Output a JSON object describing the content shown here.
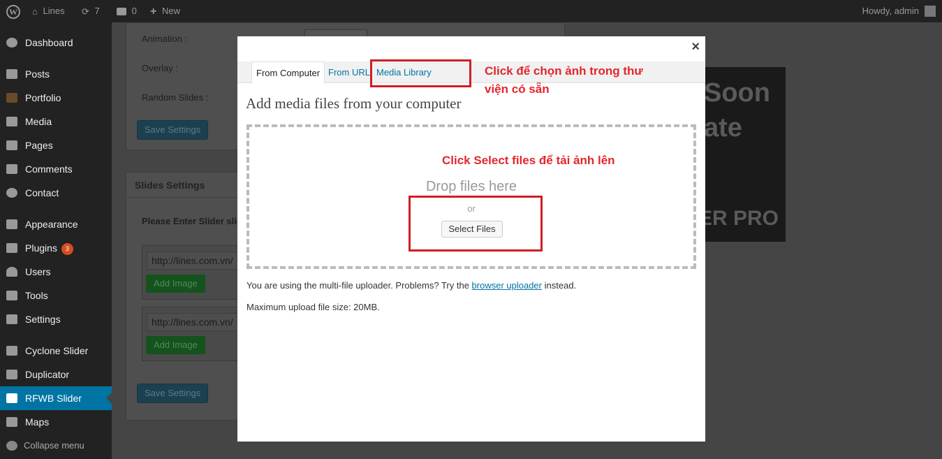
{
  "adminbar": {
    "site_name": "Lines",
    "updates_count": "7",
    "comments_count": "0",
    "new_label": "New",
    "howdy": "Howdy, admin"
  },
  "sidebar": {
    "items": [
      {
        "label": "Dashboard",
        "icon": "dashboard-icon"
      },
      {
        "label": "Posts",
        "icon": "pin-icon"
      },
      {
        "label": "Portfolio",
        "icon": "briefcase-icon"
      },
      {
        "label": "Media",
        "icon": "media-icon"
      },
      {
        "label": "Pages",
        "icon": "pages-icon"
      },
      {
        "label": "Comments",
        "icon": "comment-icon"
      },
      {
        "label": "Contact",
        "icon": "gear-icon"
      },
      {
        "label": "Appearance",
        "icon": "brush-icon"
      },
      {
        "label": "Plugins",
        "icon": "plug-icon",
        "badge": "3"
      },
      {
        "label": "Users",
        "icon": "user-icon"
      },
      {
        "label": "Tools",
        "icon": "wrench-icon"
      },
      {
        "label": "Settings",
        "icon": "settings-icon"
      },
      {
        "label": "Cyclone Slider",
        "icon": "slider-icon"
      },
      {
        "label": "Duplicator",
        "icon": "duplicator-icon"
      },
      {
        "label": "RFWB Slider",
        "icon": "rfwb-slider-icon",
        "active": true
      },
      {
        "label": "Maps",
        "icon": "map-icon"
      },
      {
        "label": "Collapse menu",
        "icon": "collapse-icon"
      }
    ]
  },
  "background": {
    "animation_label": "Animation :",
    "overlay_label": "Overlay :",
    "random_slides_label": "Random Slides :",
    "save_settings": "Save Settings",
    "slides_settings_title": "Slides Settings",
    "enter_slider_label": "Please Enter Slider slid",
    "url_value": "http://lines.com.vn/",
    "add_image": "Add Image",
    "preview_texts": [
      "Soon",
      "ate",
      "ER PRO"
    ]
  },
  "modal": {
    "close": "×",
    "tabs": [
      "From Computer",
      "From URL",
      "Media Library"
    ],
    "title": "Add media files from your computer",
    "drop_text": "Drop files here",
    "or_text": "or",
    "select_files": "Select Files",
    "multi_uploader_prefix": "You are using the multi-file uploader. Problems? Try the",
    "browser_uploader_link": "browser uploader",
    "multi_uploader_suffix": "instead.",
    "max_upload": "Maximum upload file size: 20MB."
  },
  "annotations": {
    "media_library_note": "Click để chọn ảnh trong thư viện có sẵn",
    "select_files_note": "Click Select files để tải ảnh lên"
  },
  "colors": {
    "wp_blue": "#0074a2",
    "annotation_red": "#d01e26",
    "admin_dark": "#222222"
  }
}
